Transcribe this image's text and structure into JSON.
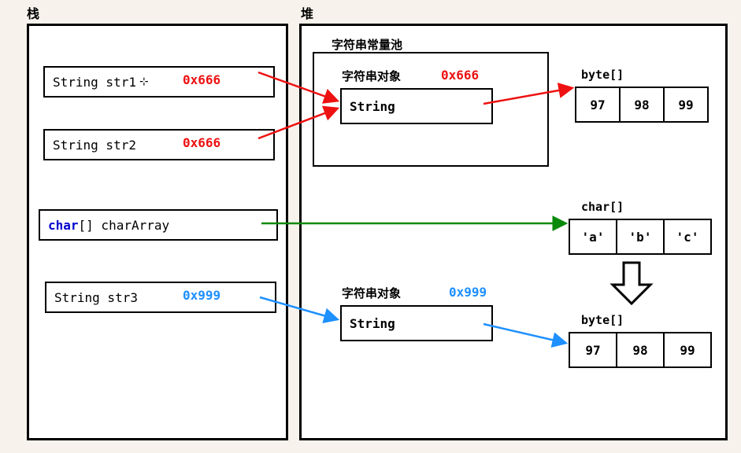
{
  "labels": {
    "stack": "栈",
    "heap": "堆",
    "string_pool": "字符串常量池",
    "string_obj1": "字符串对象",
    "string_obj2": "字符串对象",
    "byte_arr1": "byte[]",
    "char_arr": "char[]",
    "byte_arr2": "byte[]"
  },
  "stack": {
    "str1": {
      "decl": "String str1",
      "addr": "0x666"
    },
    "str2": {
      "decl": "String str2",
      "addr": "0x666"
    },
    "charArray": {
      "kw": "char",
      "rest": "[] charArray"
    },
    "str3": {
      "decl": "String str3",
      "addr": "0x999"
    }
  },
  "heap": {
    "pool_obj": {
      "value": "String",
      "addr": "0x666"
    },
    "new_obj": {
      "value": "String",
      "addr": "0x999"
    },
    "byte1": [
      "97",
      "98",
      "99"
    ],
    "chars": [
      "'a'",
      "'b'",
      "'c'"
    ],
    "byte2": [
      "97",
      "98",
      "99"
    ]
  },
  "colors": {
    "red": "#e11",
    "green": "#0a8a0a",
    "blue": "#1e90ff"
  }
}
